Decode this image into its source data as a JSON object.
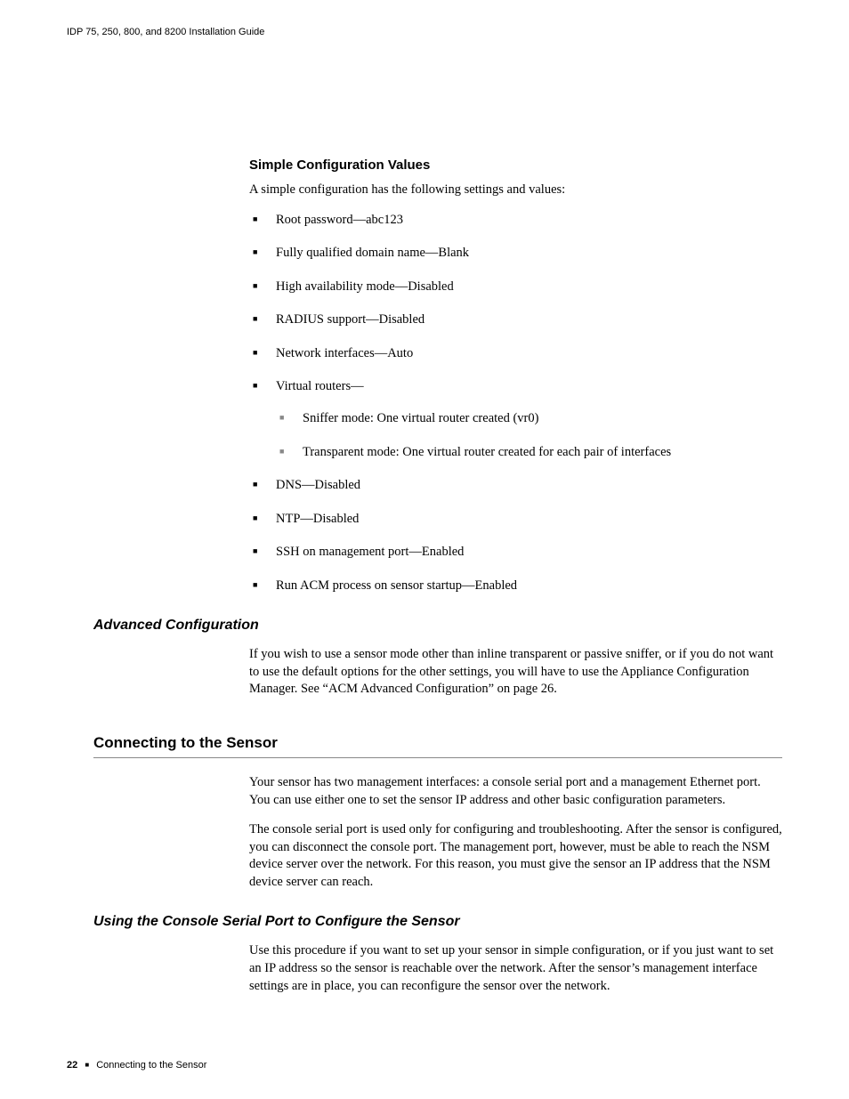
{
  "header_text": "IDP 75, 250, 800, and 8200 Installation Guide",
  "s1": {
    "heading": "Simple Configuration Values",
    "intro": "A simple configuration has the following settings and values:",
    "items": {
      "i0": "Root password—abc123",
      "i1": "Fully qualified domain name—Blank",
      "i2": "High availability mode—Disabled",
      "i3": "RADIUS support—Disabled",
      "i4": "Network interfaces—Auto",
      "i5": "Virtual routers—",
      "i5_sub": {
        "a": "Sniffer mode: One virtual router created (vr0)",
        "b": "Transparent mode: One virtual router created for each pair of interfaces"
      },
      "i6": "DNS—Disabled",
      "i7": "NTP—Disabled",
      "i8": "SSH on management port—Enabled",
      "i9": "Run ACM process on sensor startup—Enabled"
    }
  },
  "s2": {
    "heading": "Advanced Configuration",
    "para": "If you wish to use a sensor mode other than inline transparent or passive sniffer, or if you do not want to use the default options for the other settings, you will have to use the Appliance Configuration Manager. See “ACM Advanced Configuration” on page 26."
  },
  "s3": {
    "heading": "Connecting to the Sensor",
    "p1": "Your sensor has two management interfaces: a console serial port and a management Ethernet port. You can use either one to set the sensor IP address and other basic configuration parameters.",
    "p2": "The console serial port is used only for configuring and troubleshooting. After the sensor is configured, you can disconnect the console port. The management port, however, must be able to reach the NSM device server over the network. For this reason, you must give the sensor an IP address that the NSM device server can reach."
  },
  "s4": {
    "heading": "Using the Console Serial Port to Configure the Sensor",
    "para": "Use this procedure if you want to set up your sensor in simple configuration, or if you just want to set an IP address so the sensor is reachable over the network. After the sensor’s management interface settings are in place, you can reconfigure the sensor over the network."
  },
  "footer": {
    "page_number": "22",
    "section": "Connecting to the Sensor"
  }
}
